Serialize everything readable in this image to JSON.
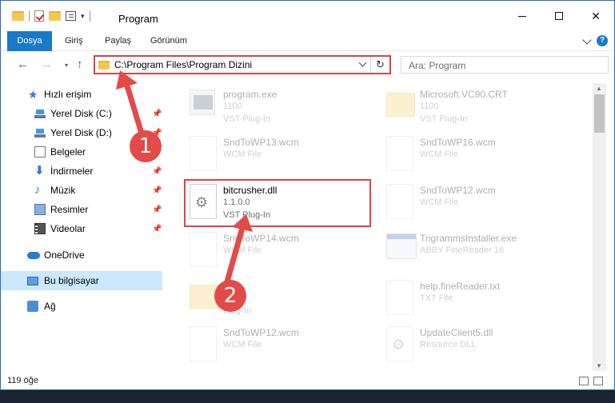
{
  "window": {
    "title": "Program",
    "controls": {
      "minimize_icon": "minimize-icon",
      "maximize_icon": "maximize-icon",
      "close_glyph": "✕"
    }
  },
  "quick_access_toolbar": {
    "items": [
      "folder-icon",
      "properties-icon",
      "new-folder-icon",
      "view-options-icon"
    ]
  },
  "ribbon": {
    "tabs": [
      "Dosya",
      "Giriş",
      "Paylaş",
      "Görünüm"
    ],
    "help_glyph": "?"
  },
  "navigation": {
    "back_glyph": "←",
    "forward_glyph": "→",
    "up_glyph": "↑",
    "dropdown_glyph": "▾",
    "address": "C:\\Program Files\\Program Dizini",
    "refresh_glyph": "↻",
    "search_placeholder": "Ara: Program"
  },
  "sidebar": {
    "items": [
      {
        "label": "Hızlı erişim",
        "icon": "star-icon",
        "pinned": false
      },
      {
        "label": "Yerel Disk (C:)",
        "icon": "disk-icon",
        "pinned": true
      },
      {
        "label": "Yerel Disk (D:)",
        "icon": "disk-icon",
        "pinned": true
      },
      {
        "label": "Belgeler",
        "icon": "document-icon",
        "pinned": true
      },
      {
        "label": "İndirmeler",
        "icon": "download-icon",
        "pinned": true
      },
      {
        "label": "Müzik",
        "icon": "music-icon",
        "pinned": true
      },
      {
        "label": "Resimler",
        "icon": "pictures-icon",
        "pinned": true
      },
      {
        "label": "Videolar",
        "icon": "videos-icon",
        "pinned": true
      },
      {
        "label": "OneDrive",
        "icon": "cloud-icon",
        "pinned": false
      },
      {
        "label": "Bu bilgisayar",
        "icon": "computer-icon",
        "pinned": false,
        "selected": true
      },
      {
        "label": "Ağ",
        "icon": "network-icon",
        "pinned": false
      }
    ],
    "pin_glyph": "📌"
  },
  "files": [
    {
      "name": "program.exe",
      "type": "1100",
      "sub": "VST Plug-In",
      "icon": "exe"
    },
    {
      "name": "Microsoft.VC90.CRT",
      "type": "1100",
      "sub": "VST Plug-In",
      "icon": "folder"
    },
    {
      "name": "SndToWP13.wcm",
      "type": "WCM File",
      "sub": "",
      "icon": "doc"
    },
    {
      "name": "SndToWP16.wcm",
      "type": "WCM File",
      "sub": "",
      "icon": "doc"
    },
    {
      "name": "bitcrusher.dll",
      "type": "1.1.0.0",
      "sub": "VST Plug-In",
      "icon": "dll",
      "highlighted": true
    },
    {
      "name": "SndToWP12.wcm",
      "type": "WCM File",
      "sub": "",
      "icon": "doc"
    },
    {
      "name": "SndToWP14.wcm",
      "type": "WCM File",
      "sub": "",
      "icon": "doc"
    },
    {
      "name": "TrigrammsInstaller.exe",
      "type": "ABBY FineReader 16",
      "sub": "",
      "icon": "app"
    },
    {
      "name": "",
      "type": "",
      "sub": "Plug-In",
      "icon": "folder"
    },
    {
      "name": "help.fineReader.txt",
      "type": "TXT File",
      "sub": "",
      "icon": "doc"
    },
    {
      "name": "SndToWP12.wcm",
      "type": "WCM File",
      "sub": "",
      "icon": "doc"
    },
    {
      "name": "UpdateClient5.dll",
      "type": "Resource DLL",
      "sub": "",
      "icon": "dll"
    }
  ],
  "status": {
    "count": "119 öğe"
  },
  "annotations": [
    {
      "number": "1",
      "color": "#e44a48"
    },
    {
      "number": "2",
      "color": "#e44a48"
    }
  ],
  "colors": {
    "accent": "#1979ca",
    "highlight": "#d94545",
    "selection": "#cce8ff"
  }
}
